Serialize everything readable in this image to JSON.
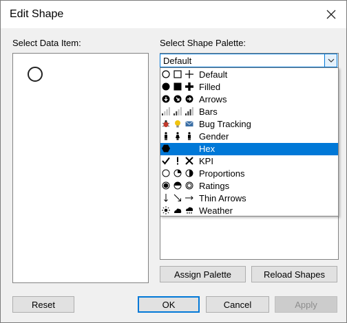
{
  "window": {
    "title": "Edit Shape"
  },
  "left": {
    "label": "Select Data Item:"
  },
  "right": {
    "label": "Select Shape Palette:",
    "selected_value": "Default",
    "options": [
      {
        "label": "Default",
        "icons": [
          "circle-outline-icon",
          "square-outline-icon",
          "plus-icon"
        ]
      },
      {
        "label": "Filled",
        "icons": [
          "filled-circle-icon",
          "filled-square-icon",
          "filled-plus-icon"
        ]
      },
      {
        "label": "Arrows",
        "icons": [
          "arrow-down-circle-icon",
          "arrow-down-right-circle-icon",
          "arrow-right-circle-icon"
        ]
      },
      {
        "label": "Bars",
        "icons": [
          "bars-low-icon",
          "bars-medium-icon",
          "bars-high-icon"
        ]
      },
      {
        "label": "Bug Tracking",
        "icons": [
          "bug-icon",
          "lightbulb-icon",
          "envelope-icon"
        ]
      },
      {
        "label": "Gender",
        "icons": [
          "male-figure-icon",
          "female-figure-icon",
          "male-figure-alt-icon"
        ]
      },
      {
        "label": "Hex",
        "icons": [
          "hexagon-icon"
        ]
      },
      {
        "label": "KPI",
        "icons": [
          "checkmark-icon",
          "exclamation-icon",
          "x-mark-icon"
        ]
      },
      {
        "label": "Proportions",
        "icons": [
          "proportion-empty-icon",
          "proportion-quarter-icon",
          "proportion-half-icon"
        ]
      },
      {
        "label": "Ratings",
        "icons": [
          "rating-full-icon",
          "rating-half-icon",
          "rating-ring-icon"
        ]
      },
      {
        "label": "Thin Arrows",
        "icons": [
          "thin-arrow-down-icon",
          "thin-arrow-down-right-icon",
          "thin-arrow-right-icon"
        ]
      },
      {
        "label": "Weather",
        "icons": [
          "sun-icon",
          "cloud-icon",
          "rain-icon"
        ]
      }
    ],
    "highlighted_index": 6
  },
  "buttons": {
    "assign_palette": "Assign Palette",
    "reload_shapes": "Reload Shapes",
    "reset": "Reset",
    "ok": "OK",
    "cancel": "Cancel",
    "apply": "Apply"
  },
  "colors": {
    "accent": "#0078d7",
    "dialog_bg": "#f0f0f0",
    "selected_text": "#ffffff"
  }
}
